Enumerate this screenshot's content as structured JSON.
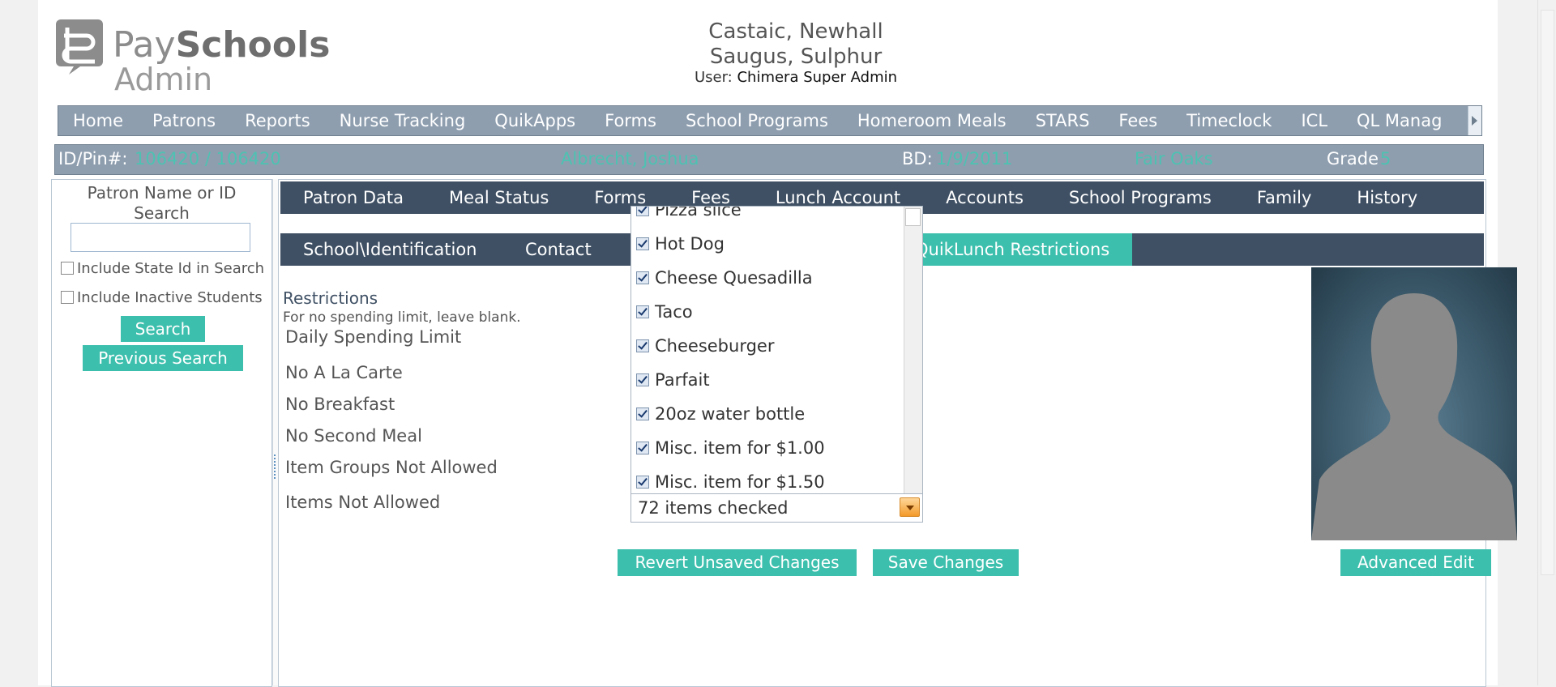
{
  "logo": {
    "pay": "Pay",
    "schools": "Schools",
    "admin": "Admin"
  },
  "header": {
    "district_line1": "Castaic, Newhall",
    "district_line2": "Saugus, Sulphur",
    "user_label": "User:",
    "user_name": "Chimera Super Admin"
  },
  "topnav": [
    "Home",
    "Patrons",
    "Reports",
    "Nurse Tracking",
    "QuikApps",
    "Forms",
    "School Programs",
    "Homeroom Meals",
    "STARS",
    "Fees",
    "Timeclock",
    "ICL",
    "QL Manag"
  ],
  "patron_bar": {
    "id_label": "ID/Pin#:",
    "id_value": "106420 / 106420",
    "name_value": "Albrecht, Joshua",
    "bd_label": "BD:",
    "bd_value": "1/9/2011",
    "school_value": "Fair Oaks",
    "grade_label": "Grade",
    "grade_value": "5"
  },
  "search_panel": {
    "title_line1": "Patron Name or ID",
    "title_line2": "Search",
    "search_value": "",
    "include_state_id": "Include State Id in Search",
    "include_inactive": "Include Inactive Students",
    "search_button": "Search",
    "previous_search_button": "Previous Search"
  },
  "main_tabs": [
    "Patron Data",
    "Meal Status",
    "Forms",
    "Fees",
    "Lunch Account",
    "Accounts",
    "School Programs",
    "Family",
    "History"
  ],
  "sub_tabs": {
    "school_identification": "School\\Identification",
    "contact": "Contact",
    "quiklunch_restrictions": "QuikLunch Restrictions"
  },
  "restrictions": {
    "title": "Restrictions",
    "note": "For no spending limit, leave blank.",
    "daily_spending_limit": "Daily Spending Limit",
    "no_a_la_carte": "No A La Carte",
    "no_breakfast": "No Breakfast",
    "no_second_meal": "No Second Meal",
    "item_groups_not_allowed": "Item Groups Not Allowed",
    "items_not_allowed": "Items Not Allowed"
  },
  "items_dropdown": {
    "options": [
      "Pizza slice",
      "Hot Dog",
      "Cheese Quesadilla",
      "Taco",
      "Cheeseburger",
      "Parfait",
      "20oz water bottle",
      "Misc. item for $1.00",
      "Misc. item for $1.50"
    ],
    "selected_text": "72 items checked"
  },
  "actions": {
    "revert": "Revert Unsaved Changes",
    "save": "Save Changes",
    "advanced_edit": "Advanced Edit"
  },
  "colors": {
    "accent": "#3dbfad",
    "nav_bg": "#8e9eaf",
    "tab_bg": "#3f5064"
  }
}
